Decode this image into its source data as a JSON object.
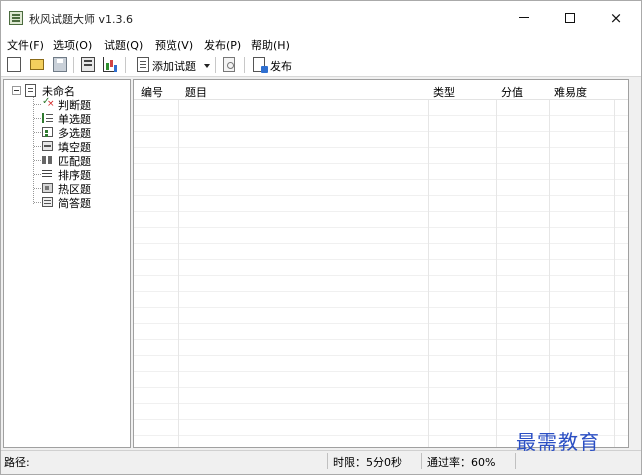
{
  "window": {
    "title": "秋风试题大师 v1.3.6",
    "controls": {
      "minimize": "minimize",
      "maximize": "maximize",
      "close": "×"
    }
  },
  "menu": {
    "items": [
      {
        "label": "文件(F)"
      },
      {
        "label": "选项(O)"
      },
      {
        "label": "试题(Q)"
      },
      {
        "label": "预览(V)"
      },
      {
        "label": "发布(P)"
      },
      {
        "label": "帮助(H)"
      }
    ]
  },
  "toolbar": {
    "icons": [
      "new-file-icon",
      "open-folder-icon",
      "save-icon",
      "properties-icon",
      "statistics-chart-icon",
      "add-question-icon",
      "preview-icon",
      "publish-icon"
    ],
    "add_question_label": "添加试题",
    "publish_label": "发布"
  },
  "tree": {
    "root_label": "未命名",
    "items": [
      {
        "label": "判断题",
        "icon": "true-false-icon"
      },
      {
        "label": "单选题",
        "icon": "single-choice-icon"
      },
      {
        "label": "多选题",
        "icon": "multiple-choice-icon"
      },
      {
        "label": "填空题",
        "icon": "fill-blank-icon"
      },
      {
        "label": "匹配题",
        "icon": "matching-icon"
      },
      {
        "label": "排序题",
        "icon": "sequence-icon"
      },
      {
        "label": "热区题",
        "icon": "hotspot-icon"
      },
      {
        "label": "简答题",
        "icon": "short-answer-icon"
      }
    ]
  },
  "list": {
    "columns": [
      "编号",
      "题目",
      "类型",
      "分值",
      "难易度"
    ],
    "rows": []
  },
  "status": {
    "path_label": "路径:",
    "time_limit": "时限：5分0秒",
    "pass_rate": "通过率：60%"
  },
  "watermark": "最需教育",
  "colors": {
    "accent": "#2b4fc4",
    "window_bg": "#f0f0f0",
    "pane_bg": "#ffffff"
  }
}
